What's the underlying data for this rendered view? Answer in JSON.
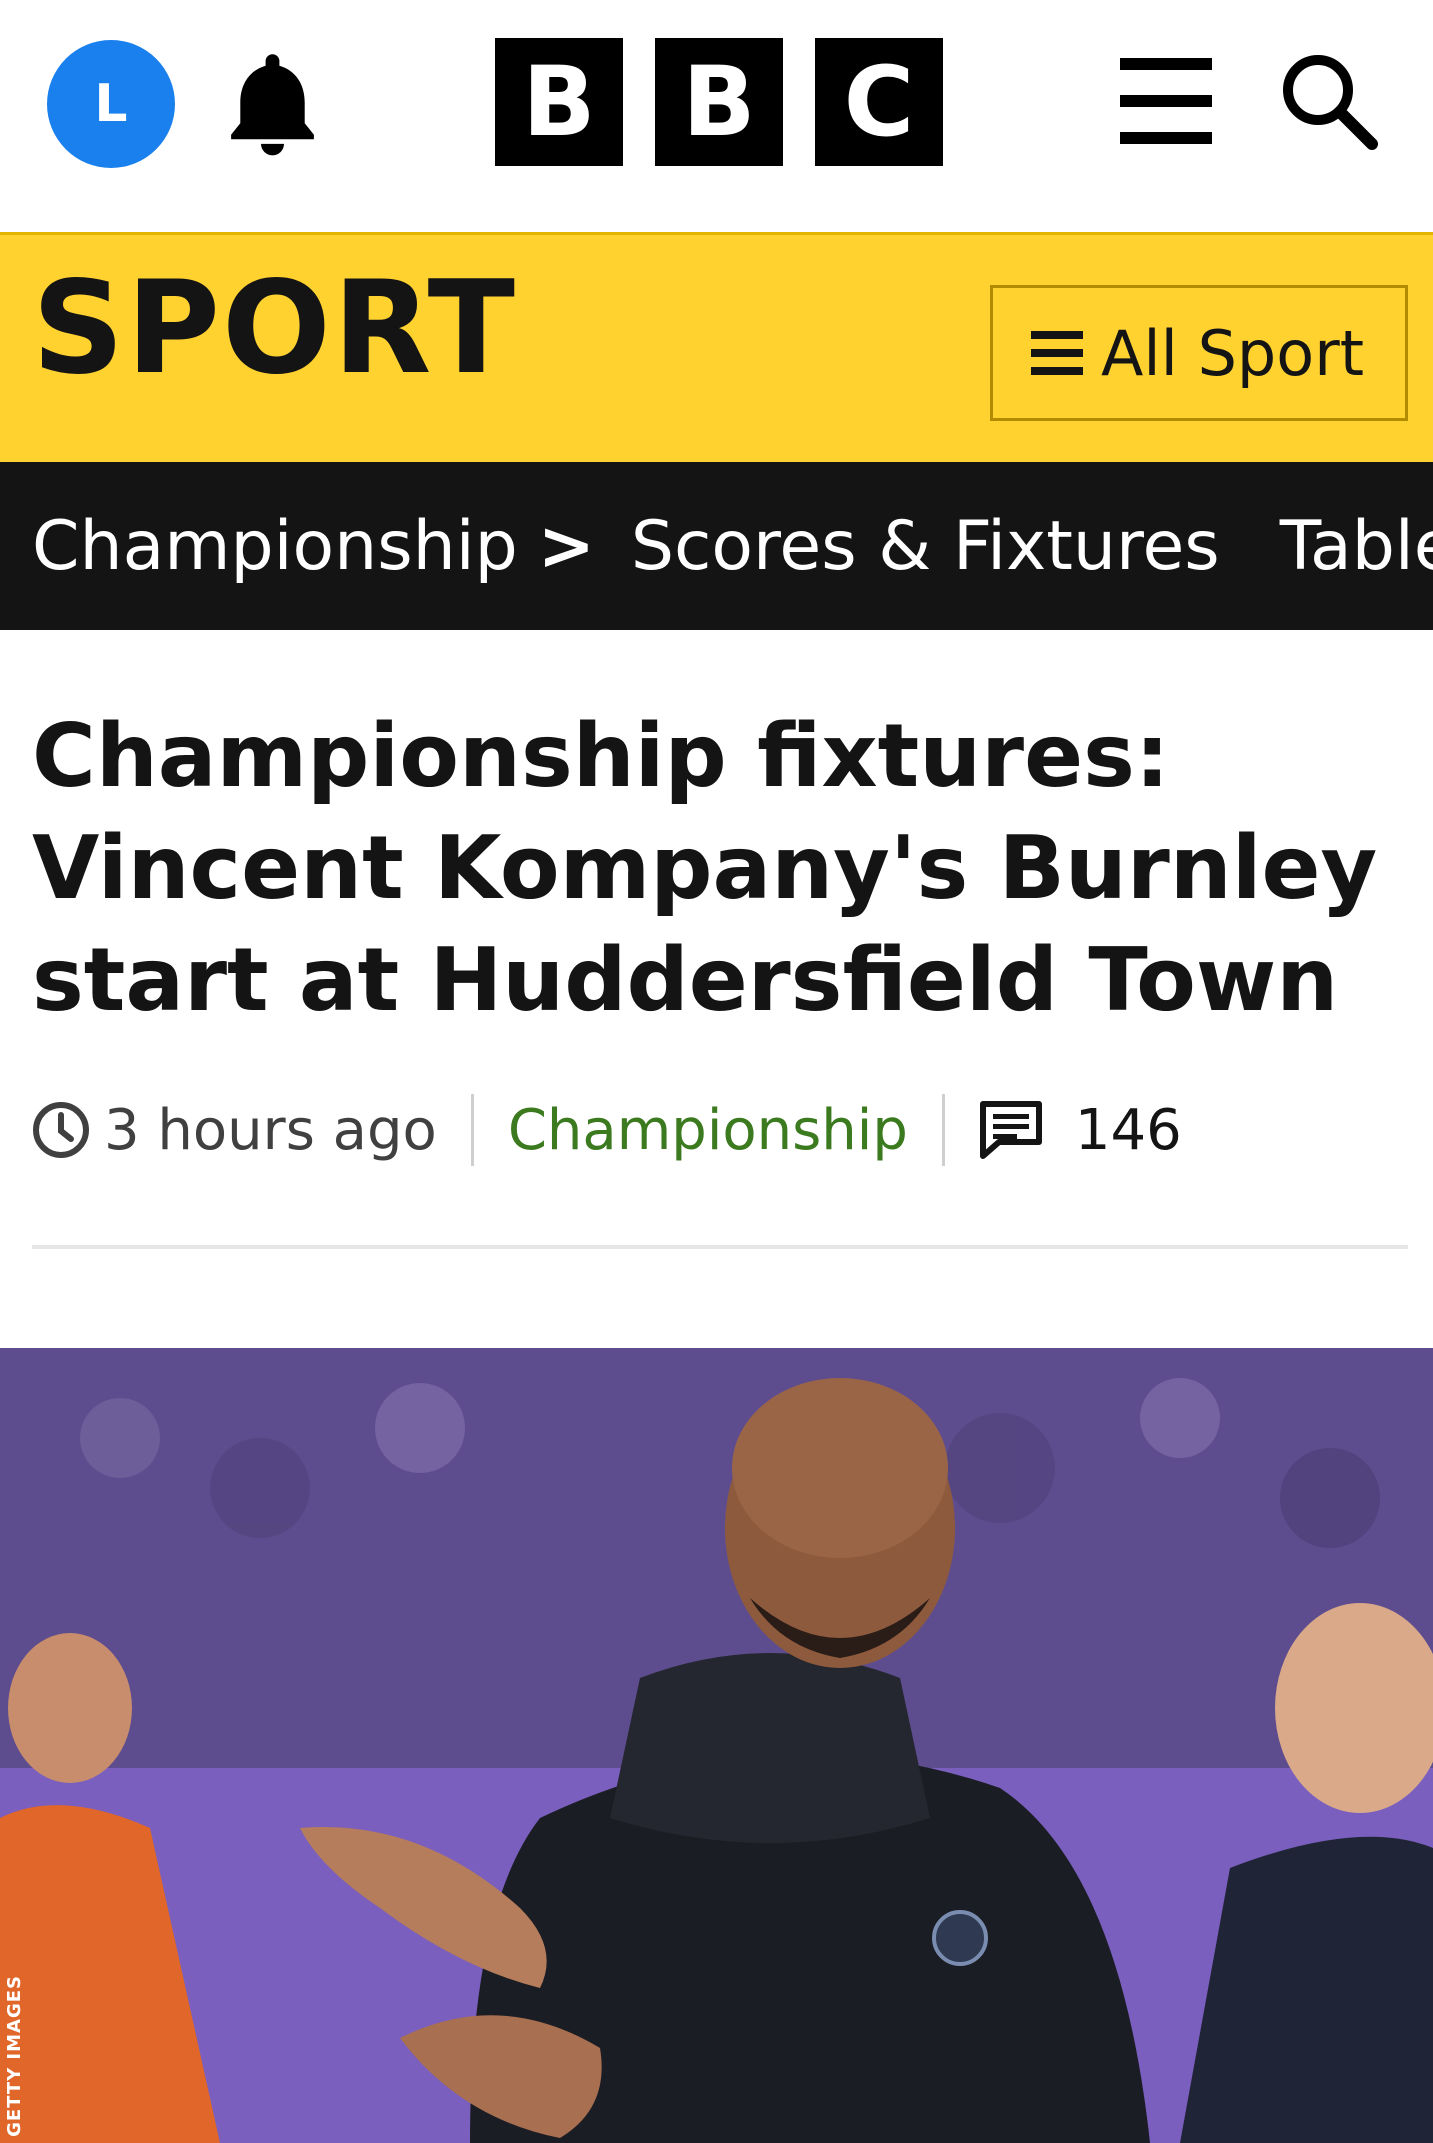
{
  "header": {
    "avatar_initial": "L",
    "logo_letters": [
      "B",
      "B",
      "C"
    ],
    "icons": {
      "notifications": "bell-icon",
      "menu": "hamburger-icon",
      "search": "search-icon"
    },
    "avatar_color": "#1a80ee"
  },
  "sport_bar": {
    "title": "SPORT",
    "all_sport_label": "All Sport",
    "background_color": "#ffd230"
  },
  "subnav": {
    "crumb": "Championship",
    "crumb_chevron": ">",
    "items": [
      "Scores & Fixtures",
      "Table"
    ]
  },
  "article": {
    "headline": "Championship fixtures: Vincent Kompany's Burnley start at Huddersfield Town",
    "time": "3 hours ago",
    "section": "Championship",
    "section_color": "#3b7a1e",
    "comment_count": "146",
    "image_credit": "GETTY IMAGES"
  }
}
